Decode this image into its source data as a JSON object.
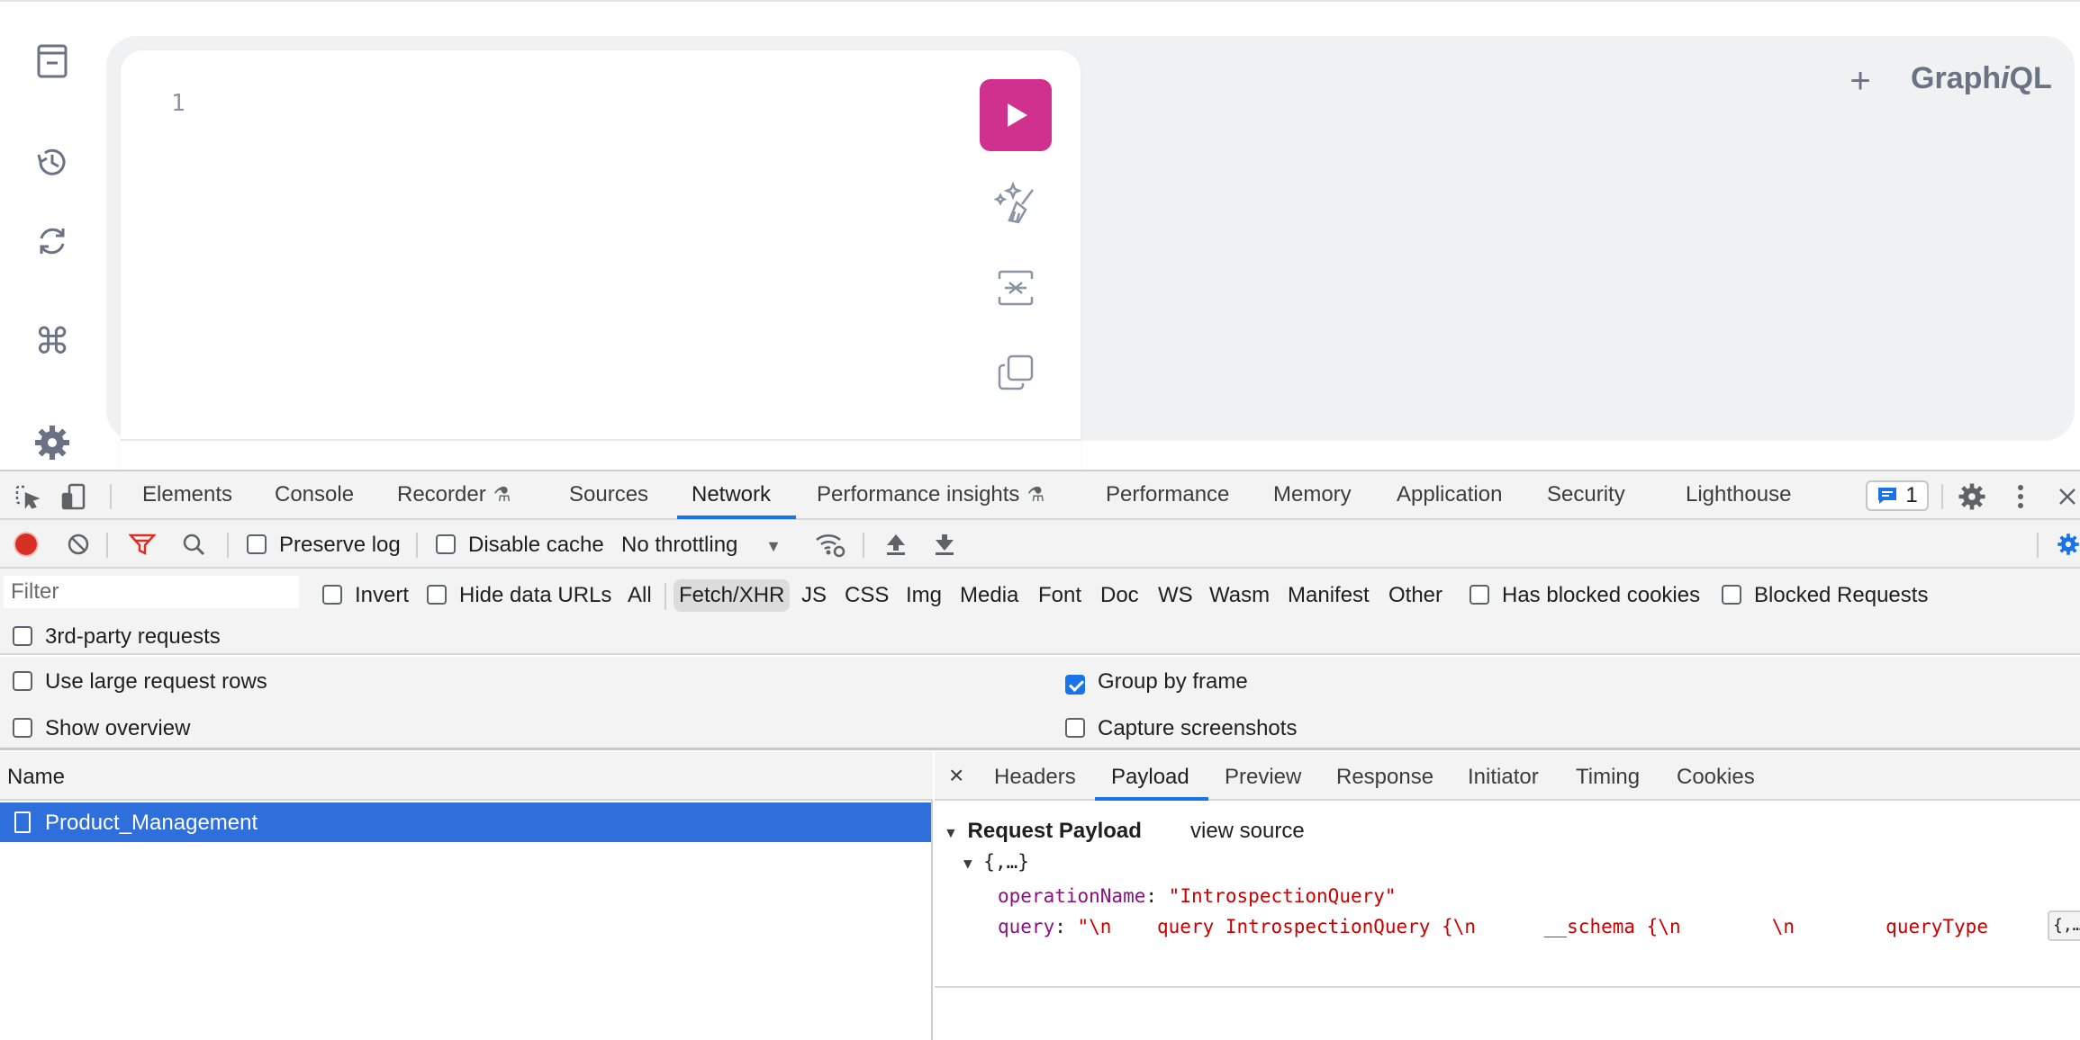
{
  "graphiql": {
    "title_pre": "Graph",
    "title_i": "i",
    "title_post": "QL",
    "line_number": "1",
    "plus": "+",
    "sidebar_icons": [
      "docs-icon",
      "history-icon",
      "refetch-schema-icon",
      "shortcuts-icon",
      "settings-icon"
    ],
    "accent": "#d0308e"
  },
  "devtools": {
    "tabs": [
      {
        "label": "Elements"
      },
      {
        "label": "Console"
      },
      {
        "label": "Recorder"
      },
      {
        "label": "Sources"
      },
      {
        "label": "Network"
      },
      {
        "label": "Performance insights"
      },
      {
        "label": "Performance"
      },
      {
        "label": "Memory"
      },
      {
        "label": "Application"
      },
      {
        "label": "Security"
      },
      {
        "label": "Lighthouse"
      }
    ],
    "active_tab": "Network",
    "issues_count": "1",
    "toolbar": {
      "preserve_log": "Preserve log",
      "disable_cache": "Disable cache",
      "throttling": "No throttling"
    },
    "filter": {
      "placeholder": "Filter",
      "invert": "Invert",
      "hide_data_urls": "Hide data URLs",
      "types": [
        "All",
        "Fetch/XHR",
        "JS",
        "CSS",
        "Img",
        "Media",
        "Font",
        "Doc",
        "WS",
        "Wasm",
        "Manifest",
        "Other"
      ],
      "active_type": "Fetch/XHR",
      "has_blocked_cookies": "Has blocked cookies",
      "blocked_requests": "Blocked Requests",
      "third_party": "3rd-party requests"
    },
    "settings": {
      "large_rows": "Use large request rows",
      "group_by_frame": "Group by frame",
      "show_overview": "Show overview",
      "capture_screenshots": "Capture screenshots"
    },
    "requests": {
      "column_name": "Name",
      "rows": [
        {
          "name": "Product_Management"
        }
      ]
    },
    "detail": {
      "close": "×",
      "tabs": [
        "Headers",
        "Payload",
        "Preview",
        "Response",
        "Initiator",
        "Timing",
        "Cookies"
      ],
      "active_tab": "Payload",
      "section_title": "Request Payload",
      "view_source": "view source",
      "object_summary": "{,…}",
      "fields": [
        {
          "key": "operationName",
          "value": "\"IntrospectionQuery\""
        },
        {
          "key": "query",
          "value": "\"\\n    query IntrospectionQuery {\\n      __schema {\\n        \\n        queryType "
        }
      ],
      "tooltip": "{,…"
    },
    "colors": {
      "accent_blue": "#1a73e8",
      "selected_row": "#2f6fdc",
      "record": "#d93025",
      "filter_icon": "#d93025"
    }
  }
}
